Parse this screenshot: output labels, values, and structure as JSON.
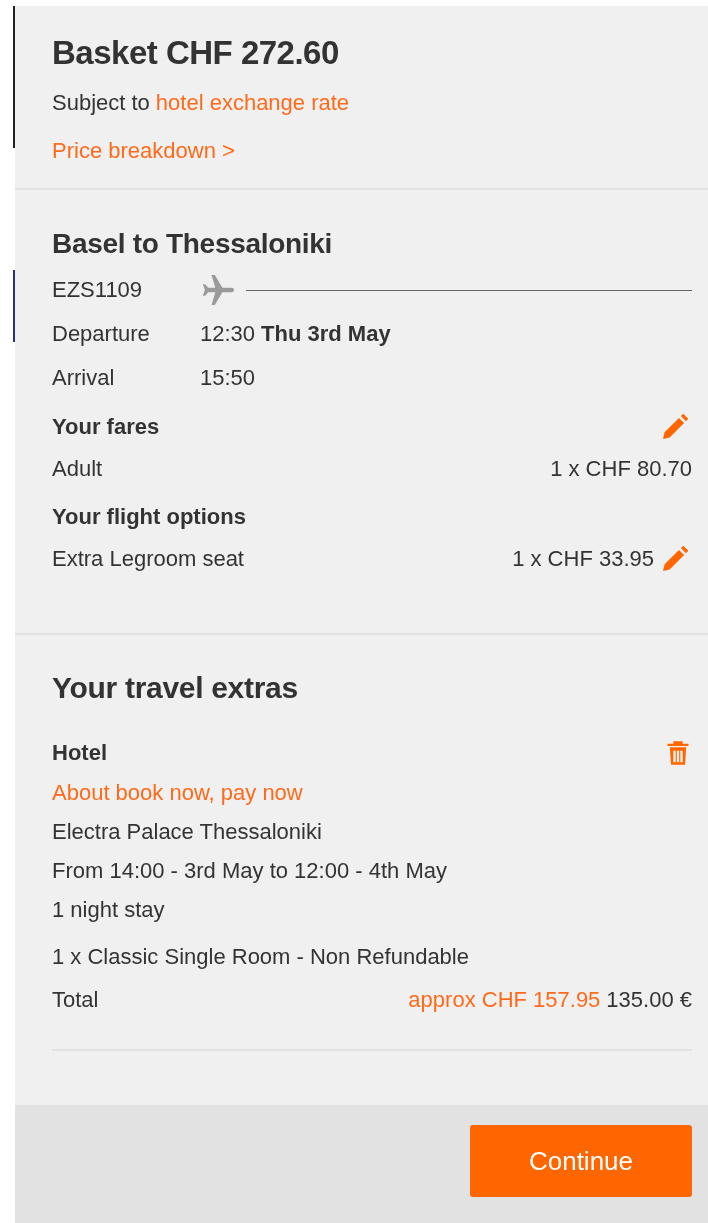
{
  "basket": {
    "title": "Basket CHF 272.60",
    "subject_prefix": "Subject to",
    "subject_link": "hotel exchange rate",
    "breakdown_link": "Price breakdown >"
  },
  "flight": {
    "route": "Basel to Thessaloniki",
    "number": "EZS1109",
    "departure": {
      "label": "Departure",
      "time": "12:30",
      "date": "Thu 3rd May"
    },
    "arrival": {
      "label": "Arrival",
      "time": "15:50"
    },
    "sections": [
      {
        "title": "Your fares",
        "edit_on_heading": true,
        "items": [
          {
            "label": "Adult",
            "price": "1 x CHF 80.70",
            "edit": false
          }
        ]
      },
      {
        "title": "Your flight options",
        "edit_on_heading": false,
        "items": [
          {
            "label": "Extra Legroom seat",
            "price": "1 x CHF 33.95",
            "edit": true
          }
        ]
      }
    ]
  },
  "extras": {
    "title": "Your travel extras",
    "hotel": {
      "heading": "Hotel",
      "link": "About book now, pay now",
      "name": "Electra Palace Thessaloniki",
      "dates": "From 14:00 - 3rd May to 12:00 - 4th May",
      "stay": "1 night stay",
      "room": "1 x Classic Single Room - Non Refundable",
      "total_label": "Total",
      "approx": "approx CHF 157.95",
      "price": "135.00 €"
    }
  },
  "continue_button": "Continue"
}
